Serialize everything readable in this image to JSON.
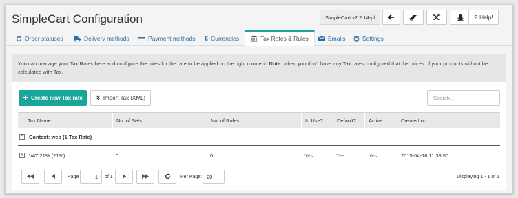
{
  "app": {
    "title": "SimpleCart Configuration",
    "version": "SimpleCart v2.2.14-pl",
    "help_label": "Help!"
  },
  "header_icons": [
    "arrow-left-icon",
    "eraser-icon",
    "random-icon",
    "bug-icon",
    "question-icon"
  ],
  "tabs": [
    {
      "label": "Order statuses",
      "icon": "refresh-icon"
    },
    {
      "label": "Delivery methods",
      "icon": "truck-icon"
    },
    {
      "label": "Payment methods",
      "icon": "credit-card-icon"
    },
    {
      "label": "Currencies",
      "icon": "euro-icon"
    },
    {
      "label": "Tax Rates & Rules",
      "icon": "bank-icon",
      "active": true
    },
    {
      "label": "Emails",
      "icon": "envelope-icon"
    },
    {
      "label": "Settings",
      "icon": "gear-icon"
    }
  ],
  "notice": {
    "text_before": "You can manage your Tax Rates here and configure the rules for the rate to be applied on the right moment.",
    "note_label": "Note:",
    "text_after": "when you don't have any Tax rates configured that the prices of your products will not be calculated with Tax."
  },
  "toolbar": {
    "create_label": "Create new Tax rate",
    "import_label": "Import Tax (XML)",
    "search_placeholder": "Search..."
  },
  "table": {
    "columns": [
      "Tax Name",
      "No. of Sets",
      "No. of Rules",
      "In Use?",
      "Default?",
      "Active",
      "Created on"
    ],
    "group": {
      "label": "Context: web (1 Tax Rate)"
    },
    "rows": [
      {
        "name": "VAT 21% (21%)",
        "sets": "0",
        "rules": "0",
        "in_use": "Yes",
        "default": "Yes",
        "active": "Yes",
        "created_on": "2015-04-16 11:38:50"
      }
    ]
  },
  "pager": {
    "page_label": "Page",
    "page_value": "1",
    "of_label": "of 1",
    "per_page_label": "Per Page:",
    "per_page_value": "20",
    "display_text": "Displaying 1 - 1 of 1"
  },
  "colors": {
    "accent": "#1aa59a",
    "link": "#2a6fa8",
    "yes": "#3a9a2a"
  }
}
